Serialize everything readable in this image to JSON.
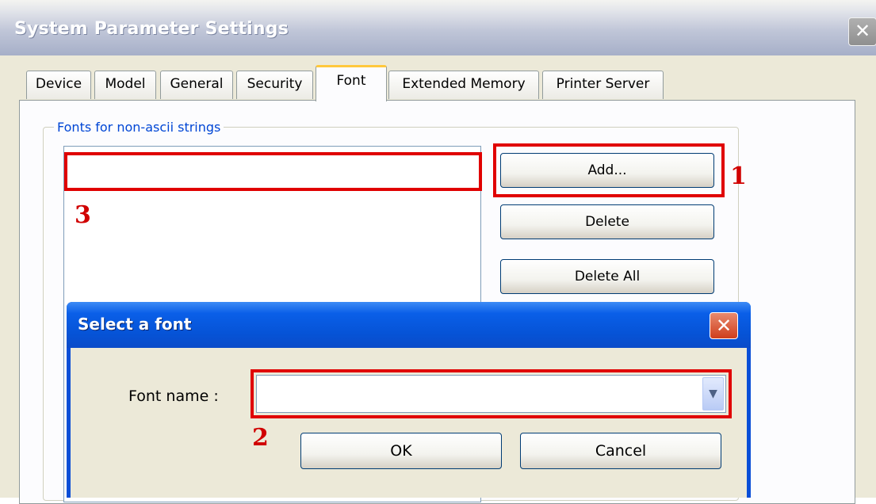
{
  "window": {
    "title": "System Parameter Settings",
    "close_glyph": "✕"
  },
  "tabs": [
    {
      "label": "Device"
    },
    {
      "label": "Model"
    },
    {
      "label": "General"
    },
    {
      "label": "Security"
    },
    {
      "label": "Font",
      "active": true
    },
    {
      "label": "Extended Memory"
    },
    {
      "label": "Printer Server"
    }
  ],
  "font_panel": {
    "group_label": "Fonts for non-ascii strings",
    "buttons": {
      "add": "Add...",
      "delete": "Delete",
      "delete_all": "Delete All"
    }
  },
  "annotations": {
    "marker_1": "1",
    "marker_2": "2",
    "marker_3": "3",
    "color": "#e00000"
  },
  "dialog": {
    "title": "Select a font",
    "close_glyph": "✕",
    "font_name_label": "Font name :",
    "font_name_value": "",
    "ok": "OK",
    "cancel": "Cancel"
  },
  "colors": {
    "dialog_title_blue": "#0a5fe8",
    "window_bg": "#ece9d8",
    "group_label_blue": "#0046d5"
  }
}
